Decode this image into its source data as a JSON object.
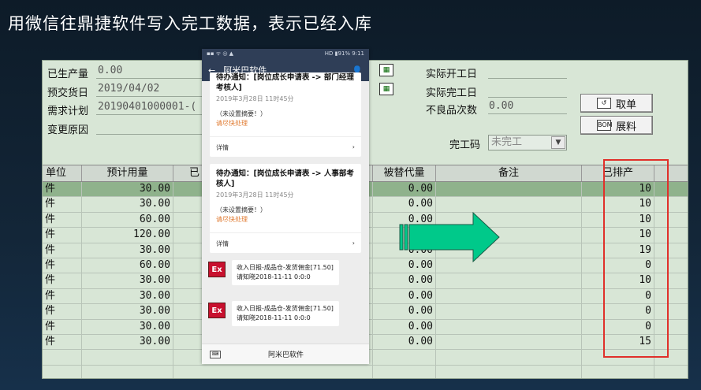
{
  "headline": "用微信往鼎捷软件写入完工数据，表示已经入库",
  "form": {
    "produced_label": "已生产量",
    "produced_value": "0.00",
    "due_label": "预交货日",
    "due_value": "2019/04/02",
    "plan_label": "需求计划",
    "plan_value": "20190401000001-(",
    "reason_label": "变更原因",
    "actual_start_label": "实际开工日",
    "actual_end_label": "实际完工日",
    "defect_label": "不良品次数",
    "defect_value": "0.00",
    "finish_code_label": "完工码",
    "finish_code_value": "未完工",
    "cal_icon_label": "▦"
  },
  "buttons": {
    "cancel": "取单",
    "cancel_icon": "↺",
    "expand": "展料",
    "expand_icon": "BOM"
  },
  "grid": {
    "headers": [
      "单位",
      "预计用量",
      "已",
      "被替代量",
      "备注",
      "已排产"
    ],
    "rows": [
      {
        "unit": "件",
        "plan": "30.00",
        "sub": "0.00",
        "done": "10"
      },
      {
        "unit": "件",
        "plan": "30.00",
        "sub": "0.00",
        "done": "10"
      },
      {
        "unit": "件",
        "plan": "60.00",
        "sub": "0.00",
        "done": "10"
      },
      {
        "unit": "件",
        "plan": "120.00",
        "sub": "0.00",
        "done": "10"
      },
      {
        "unit": "件",
        "plan": "30.00",
        "sub": "0.00",
        "done": "19"
      },
      {
        "unit": "件",
        "plan": "60.00",
        "sub": "0.00",
        "done": "0"
      },
      {
        "unit": "件",
        "plan": "30.00",
        "sub": "0.00",
        "done": "10"
      },
      {
        "unit": "件",
        "plan": "30.00",
        "sub": "0.00",
        "done": "0"
      },
      {
        "unit": "件",
        "plan": "30.00",
        "sub": "0.00",
        "done": "0"
      },
      {
        "unit": "件",
        "plan": "30.00",
        "sub": "0.00",
        "done": "0"
      },
      {
        "unit": "件",
        "plan": "30.00",
        "sub": "0.00",
        "done": "15"
      }
    ]
  },
  "phone": {
    "status_left": "▪▪ ᯤ ◎ ▲",
    "status_right": "HD ▮91% 9:11",
    "back": "←",
    "title": "阿米巴软件",
    "user_icon": "👤",
    "card1_title": "待办通知：[岗位成长申请表 -> 部门经理考核人]",
    "card1_date": "2019年3月28日 11时45分",
    "card1_note": "（未设置摘要！）",
    "card1_action": "请尽快处理",
    "card1_more": "详情",
    "card2_title": "待办通知：[岗位成长申请表 -> 人事部考核人]",
    "card2_date": "2019年3月28日 11时45分",
    "card2_note": "（未设置摘要！）",
    "card2_action": "请尽快处理",
    "card2_more": "详情",
    "chevron": "›",
    "msg_icon": "Ex",
    "msg1": "收入日报-成品仓-发货佣金[71.50]请知晓2018-11-11 0:0:0",
    "msg2": "收入日报-成品仓-发货佣金[71.50]请知晓2018-11-11 0:0:0",
    "keyboard_icon": "⌨",
    "footer": "阿米巴软件"
  },
  "colors": {
    "highlight": "#e0302a",
    "arrow": "#00c98a",
    "selected_row": "#8fb28c"
  }
}
